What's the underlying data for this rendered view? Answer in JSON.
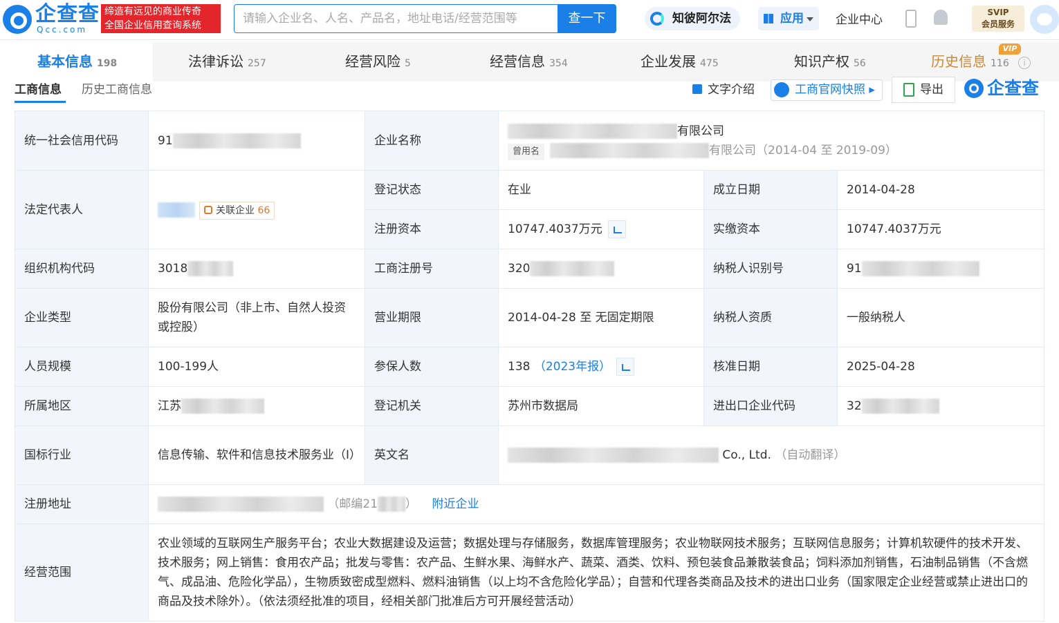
{
  "header": {
    "logo_text": "企查查",
    "logo_sub": "Qcc.com",
    "slogan_line1": "缔造有远见的商业传奇",
    "slogan_line2": "全国企业信用查询系统",
    "search_placeholder": "请输入企业名、人名、产品名，地址电话/经营范围等",
    "search_button": "查一下",
    "zhibi_label": "知彼阿尔法",
    "app_label": "应用",
    "center_label": "企业中心",
    "svip_line1": "SVIP",
    "svip_line2": "会员服务"
  },
  "tabs": [
    {
      "label": "基本信息",
      "count": "198"
    },
    {
      "label": "法律诉讼",
      "count": "257"
    },
    {
      "label": "经营风险",
      "count": "5"
    },
    {
      "label": "经营信息",
      "count": "354"
    },
    {
      "label": "企业发展",
      "count": "475"
    },
    {
      "label": "知识产权",
      "count": "56"
    },
    {
      "label": "历史信息",
      "count": "116"
    }
  ],
  "vip_tag": "VIP",
  "subtabs": {
    "active": "工商信息",
    "other": "历史工商信息"
  },
  "toolbar": {
    "text_intro": "文字介绍",
    "snapshot": "工商官网快照",
    "export": "导出",
    "brand": "企查查"
  },
  "labels": {
    "credit_code": "统一社会信用代码",
    "company_name": "企业名称",
    "legal_rep": "法定代表人",
    "reg_status": "登记状态",
    "founded": "成立日期",
    "reg_capital": "注册资本",
    "paid_capital": "实缴资本",
    "org_code": "组织机构代码",
    "reg_no": "工商注册号",
    "taxpayer_id": "纳税人识别号",
    "company_type": "企业类型",
    "biz_term": "营业期限",
    "taxpayer_qual": "纳税人资质",
    "staff_size": "人员规模",
    "insured": "参保人数",
    "approval_date": "核准日期",
    "region": "所属地区",
    "reg_authority": "登记机关",
    "ie_code": "进出口企业代码",
    "industry": "国标行业",
    "english_name": "英文名",
    "reg_address": "注册地址",
    "biz_scope": "经营范围"
  },
  "values": {
    "credit_code_prefix": "91",
    "company_name_suffix": "有限公司",
    "former_name_tag": "曾用名",
    "former_name_suffix": "有限公司（2014-04 至 2019-09）",
    "assoc_label": "关联企业",
    "assoc_count": "66",
    "reg_status": "在业",
    "founded": "2014-04-28",
    "reg_capital": "10747.4037万元",
    "paid_capital": "10747.4037万元",
    "org_code_prefix": "3018",
    "reg_no_prefix": "320",
    "taxpayer_id_prefix": "91",
    "company_type": "股份有限公司（非上市、自然人投资或控股）",
    "biz_term": "2014-04-28 至 无固定期限",
    "taxpayer_qual": "一般纳税人",
    "staff_size": "100-199人",
    "insured": "138",
    "insured_year": "（2023年报）",
    "approval_date": "2025-04-28",
    "region_prefix": "江苏",
    "reg_authority": "苏州市数据局",
    "ie_code_prefix": "32",
    "industry": "信息传输、软件和信息技术服务业（I）",
    "english_suffix": "Co., Ltd.",
    "english_note": "（自动翻译）",
    "postcode": "（邮编21",
    "postcode_end": "）",
    "nearby": "附近企业",
    "biz_scope": "农业领域的互联网生产服务平台；农业大数据建设及运营；数据处理与存储服务，数据库管理服务；农业物联网技术服务；互联网信息服务；计算机软硬件的技术开发、技术服务；网上销售：食用农产品；批发与零售：农产品、生鲜水果、海鲜水产、蔬菜、酒类、饮料、预包装食品兼散装食品；饲料添加剂销售，石油制品销售（不含燃气、成品油、危险化学品），生物质致密成型燃料、燃料油销售（以上均不含危险化学品）；自营和代理各类商品及技术的进出口业务（国家限定企业经营或禁止进出口的商品及技术除外）。（依法须经批准的项目，经相关部门批准后方可开展经营活动）"
  }
}
